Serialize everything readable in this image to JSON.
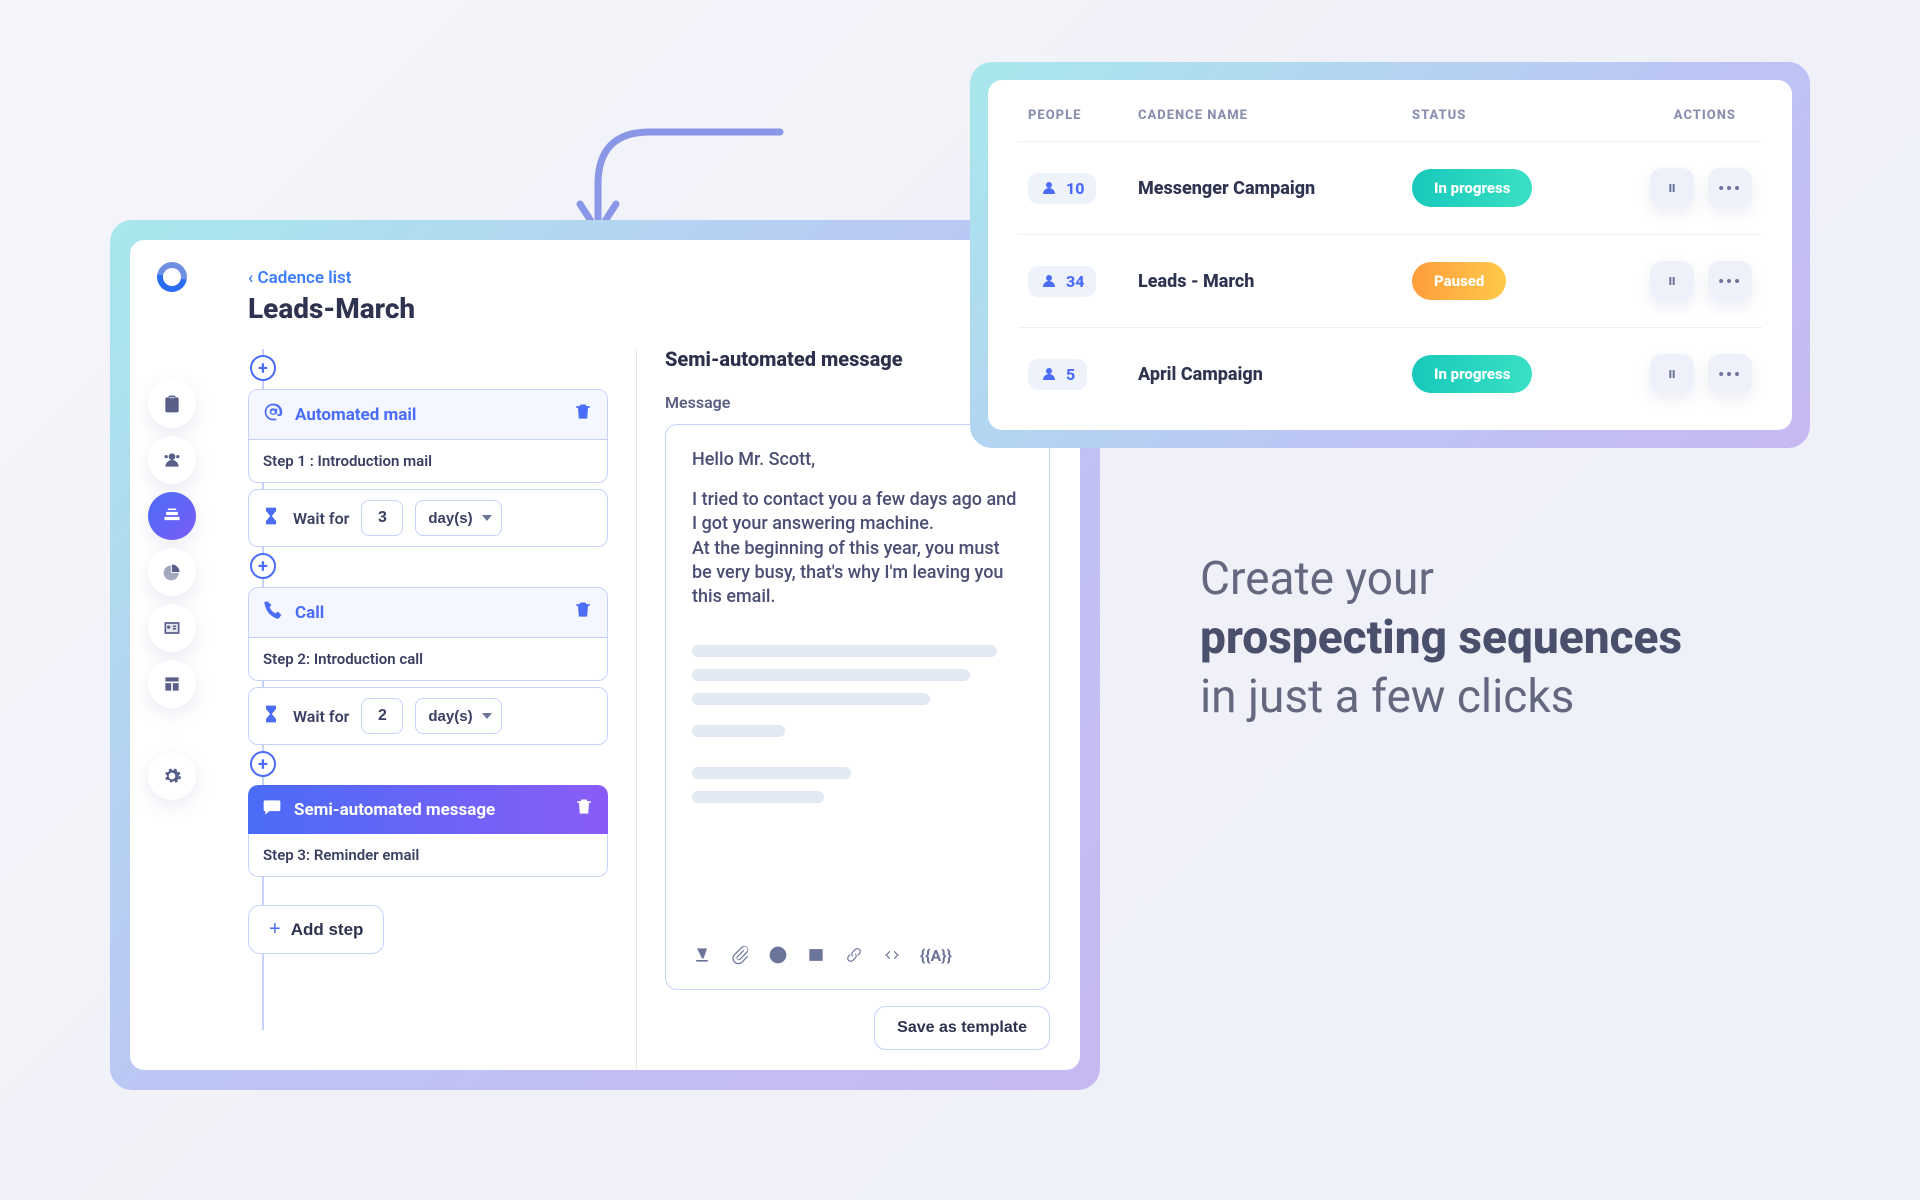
{
  "breadcrumb": {
    "back_label": "Cadence list"
  },
  "page": {
    "title": "Leads-March"
  },
  "steps": [
    {
      "type": "mail",
      "title": "Automated mail",
      "subtitle": "Step 1 : Introduction mail"
    },
    {
      "type": "wait",
      "label": "Wait for",
      "value": "3",
      "unit": "day(s)"
    },
    {
      "type": "call",
      "title": "Call",
      "subtitle": "Step 2: Introduction call"
    },
    {
      "type": "wait",
      "label": "Wait for",
      "value": "2",
      "unit": "day(s)"
    },
    {
      "type": "message",
      "selected": true,
      "title": "Semi-automated message",
      "subtitle": "Step 3: Reminder email"
    }
  ],
  "add_step_label": "Add step",
  "message_panel": {
    "title": "Semi-automated message",
    "label": "Message",
    "greeting": "Hello Mr. Scott,",
    "body": "I tried to contact you a few days ago and I got your answering machine.\nAt the beginning of this year, you must be very busy, that's why I'm leaving you this email.",
    "variable_token": "{{A}}",
    "save_template_label": "Save as template"
  },
  "cadence_table": {
    "headers": {
      "people": "PEOPLE",
      "name": "CADENCE NAME",
      "status": "STATUS",
      "actions": "ACTIONS"
    },
    "rows": [
      {
        "people": "10",
        "name": "Messenger Campaign",
        "status_label": "In progress",
        "status_kind": "progress"
      },
      {
        "people": "34",
        "name": "Leads - March",
        "status_label": "Paused",
        "status_kind": "paused"
      },
      {
        "people": "5",
        "name": "April Campaign",
        "status_label": "In progress",
        "status_kind": "progress"
      }
    ]
  },
  "tagline": {
    "line1": "Create your",
    "line2": "prospecting sequences",
    "line3": "in just a few clicks"
  }
}
